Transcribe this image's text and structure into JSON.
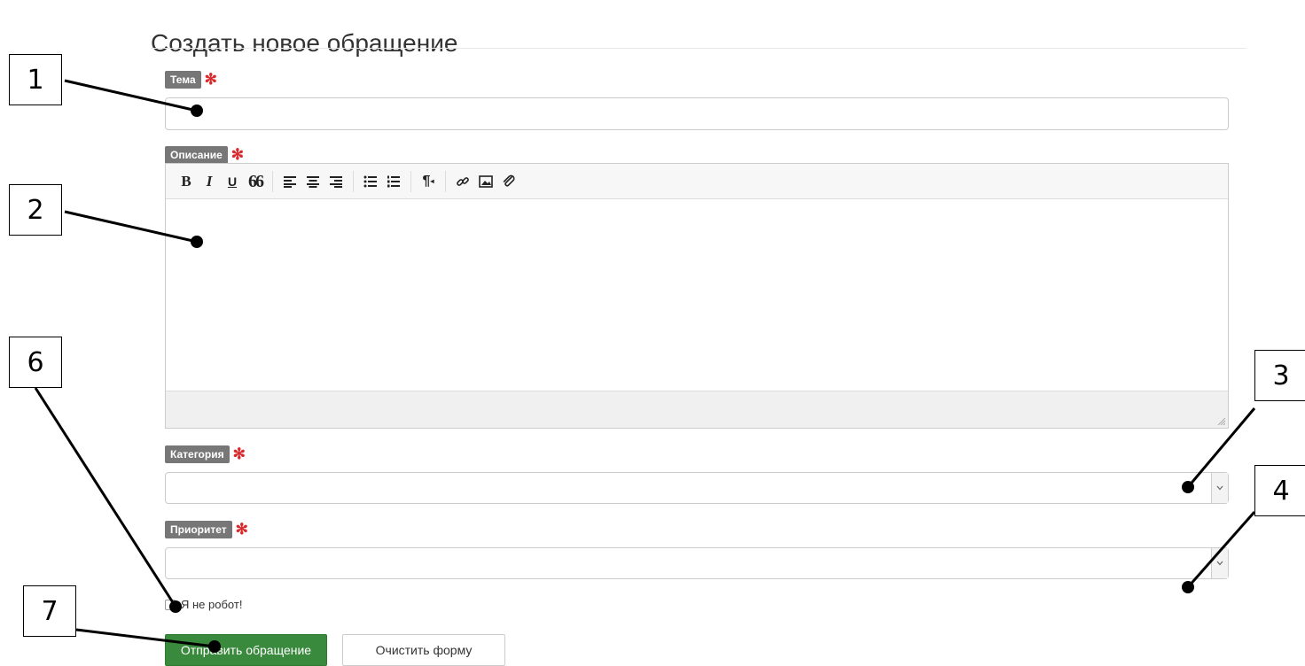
{
  "page": {
    "title": "Создать новое обращение"
  },
  "form": {
    "subject": {
      "label": "Тема",
      "required_mark": "✻",
      "value": ""
    },
    "description": {
      "label": "Описание",
      "required_mark": "✻",
      "value": "",
      "toolbar": [
        {
          "name": "bold-icon",
          "glyph": "B"
        },
        {
          "name": "italic-icon",
          "glyph": "I"
        },
        {
          "name": "underline-icon",
          "glyph": "U"
        },
        {
          "name": "quote-icon",
          "glyph": "66"
        },
        {
          "name": "align-left-icon"
        },
        {
          "name": "align-center-icon"
        },
        {
          "name": "align-right-icon"
        },
        {
          "name": "bullet-list-icon"
        },
        {
          "name": "numbered-list-icon"
        },
        {
          "name": "paragraph-icon",
          "glyph": "¶"
        },
        {
          "name": "link-icon"
        },
        {
          "name": "image-icon"
        },
        {
          "name": "attachment-icon"
        }
      ]
    },
    "category": {
      "label": "Категория",
      "required_mark": "✻",
      "selected": ""
    },
    "priority": {
      "label": "Приоритет",
      "required_mark": "✻",
      "selected": ""
    },
    "captcha": {
      "label": "Я не робот!",
      "checked": false
    },
    "buttons": {
      "submit": "Отправить обращение",
      "reset": "Очистить форму"
    }
  },
  "callouts": [
    "1",
    "2",
    "3",
    "4",
    "6",
    "7"
  ],
  "colors": {
    "submit_bg": "#3a8a3e",
    "badge_bg": "#777777",
    "required": "#d9292c"
  }
}
